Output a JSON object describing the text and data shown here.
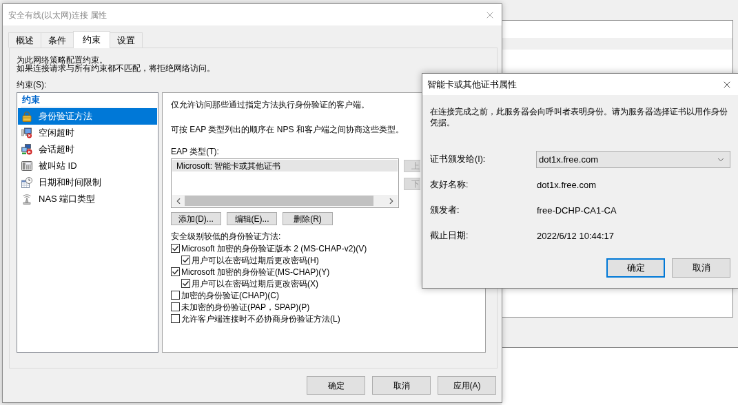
{
  "main_dialog": {
    "title": "安全有线(以太网)连接 属性",
    "tabs": [
      {
        "label": "概述",
        "selected": false
      },
      {
        "label": "条件",
        "selected": false
      },
      {
        "label": "约束",
        "selected": true
      },
      {
        "label": "设置",
        "selected": false
      }
    ],
    "intro": [
      "为此网络策略配置约束。",
      "如果连接请求与所有约束都不匹配，将拒绝网络访问。"
    ],
    "constraints": {
      "label": "约束(S):",
      "header": "约束",
      "items": [
        {
          "label": "身份验证方法",
          "selected": true
        },
        {
          "label": "空闲超时",
          "selected": false
        },
        {
          "label": "会话超时",
          "selected": false
        },
        {
          "label": "被叫站 ID",
          "selected": false
        },
        {
          "label": "日期和时间限制",
          "selected": false
        },
        {
          "label": "NAS 端口类型",
          "selected": false
        }
      ]
    },
    "auth_methods": {
      "description": "仅允许访问那些通过指定方法执行身份验证的客户端。",
      "order_note": "可按 EAP 类型列出的顺序在 NPS 和客户端之间协商这些类型。",
      "eap_label": "EAP 类型(T):",
      "eap_types": [
        {
          "label": "Microsoft: 智能卡或其他证书",
          "selected": true
        }
      ],
      "move_buttons": [
        {
          "label": "上",
          "disabled": true
        },
        {
          "label": "下",
          "disabled": true
        }
      ],
      "eap_buttons": [
        "添加(D)...",
        "编辑(E)...",
        "删除(R)"
      ],
      "less_secure_label": "安全级别较低的身份验证方法:",
      "methods": [
        {
          "label": "Microsoft 加密的身份验证版本 2 (MS-CHAP-v2)(V)",
          "checked": true,
          "children": [
            {
              "label": "用户可以在密码过期后更改密码(H)",
              "checked": true
            }
          ]
        },
        {
          "label": "Microsoft 加密的身份验证(MS-CHAP)(Y)",
          "checked": true,
          "children": [
            {
              "label": "用户可以在密码过期后更改密码(X)",
              "checked": true
            }
          ]
        },
        {
          "label": "加密的身份验证(CHAP)(C)",
          "checked": false
        },
        {
          "label": "未加密的身份验证(PAP，SPAP)(P)",
          "checked": false
        },
        {
          "label": "允许客户端连接时不必协商身份验证方法(L)",
          "checked": false
        }
      ]
    },
    "buttons": [
      "确定",
      "取消",
      "应用(A)"
    ]
  },
  "cert_dialog": {
    "title": "智能卡或其他证书属性",
    "description": "在连接完成之前，此服务器会向呼叫者表明身份。请为服务器选择证书以用作身份凭据。",
    "fields": [
      {
        "label": "证书颁发给(I):",
        "value": "dot1x.free.com",
        "kind": "dropdown"
      },
      {
        "label": "友好名称:",
        "value": "dot1x.free.com",
        "kind": "text"
      },
      {
        "label": "颁发者:",
        "value": "free-DCHP-CA1-CA",
        "kind": "text"
      },
      {
        "label": "截止日期:",
        "value": "2022/6/12 10:44:17",
        "kind": "text"
      }
    ],
    "buttons": [
      {
        "label": "确定",
        "default": true
      },
      {
        "label": "取消",
        "default": false
      }
    ]
  }
}
